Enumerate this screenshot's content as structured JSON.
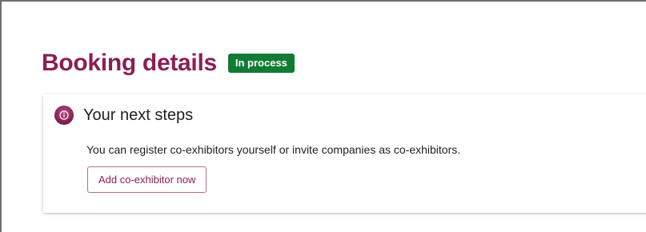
{
  "header": {
    "title": "Booking details",
    "status": "In process"
  },
  "next_steps": {
    "icon": "info-icon",
    "title": "Your next steps",
    "text": "You can register co-exhibitors yourself or invite companies as co-exhibitors.",
    "button_label": "Add co-exhibitor now"
  },
  "colors": {
    "brand": "#8a1f56",
    "status_badge": "#117a34"
  }
}
